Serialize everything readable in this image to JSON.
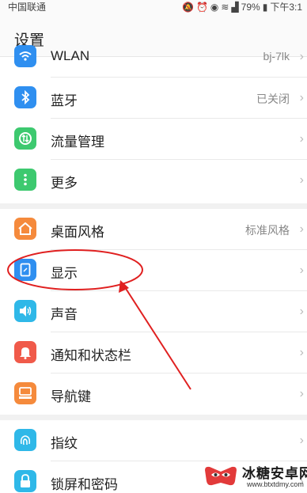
{
  "status_bar": {
    "carrier": "中国联通",
    "battery": "79%",
    "time": "下午3:1"
  },
  "header": {
    "title": "设置"
  },
  "groups": [
    {
      "items": [
        {
          "label": "WLAN",
          "value": "bj-7lk",
          "icon": "wifi-icon",
          "color": "#2f8ff0"
        },
        {
          "label": "蓝牙",
          "value": "已关闭",
          "icon": "bluetooth-icon",
          "color": "#2f8ff0"
        },
        {
          "label": "流量管理",
          "value": "",
          "icon": "data-usage-icon",
          "color": "#3dc96f"
        },
        {
          "label": "更多",
          "value": "",
          "icon": "more-icon",
          "color": "#3dc96f"
        }
      ]
    },
    {
      "items": [
        {
          "label": "桌面风格",
          "value": "标准风格",
          "icon": "home-style-icon",
          "color": "#f58a3c"
        },
        {
          "label": "显示",
          "value": "",
          "icon": "display-icon",
          "color": "#2f8ff0"
        },
        {
          "label": "声音",
          "value": "",
          "icon": "sound-icon",
          "color": "#2fb8e8"
        },
        {
          "label": "通知和状态栏",
          "value": "",
          "icon": "notification-icon",
          "color": "#f05a4a"
        },
        {
          "label": "导航键",
          "value": "",
          "icon": "nav-key-icon",
          "color": "#f58a3c"
        }
      ]
    },
    {
      "items": [
        {
          "label": "指纹",
          "value": "",
          "icon": "fingerprint-icon",
          "color": "#2fb8e8"
        },
        {
          "label": "锁屏和密码",
          "value": "",
          "icon": "lock-icon",
          "color": "#2fb8e8"
        }
      ]
    }
  ],
  "chevron": "›",
  "annotation": {
    "color": "#e02020"
  },
  "watermark": {
    "title": "冰糖安卓网",
    "url": "www.btxtdmy.com"
  }
}
